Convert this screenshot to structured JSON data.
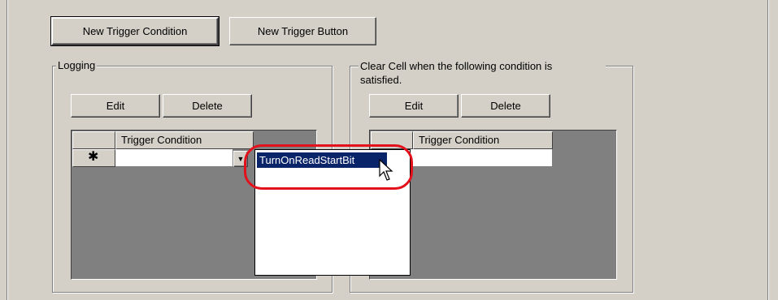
{
  "toolbar": {
    "new_trigger_condition": "New Trigger Condition",
    "new_trigger_button": "New Trigger Button"
  },
  "logging": {
    "title": "Logging",
    "edit": "Edit",
    "delete": "Delete",
    "grid_header": "Trigger Condition",
    "new_row_marker": "✱"
  },
  "clear_cell": {
    "title_line1": "Clear Cell when the following condition is",
    "title_line2": "satisfied.",
    "edit": "Edit",
    "delete": "Delete",
    "grid_header": "Trigger Condition"
  },
  "dropdown": {
    "selected_item": "TurnOnReadStartBit"
  },
  "colors": {
    "highlight_ring": "#e3111b",
    "selection": "#0a246a"
  }
}
